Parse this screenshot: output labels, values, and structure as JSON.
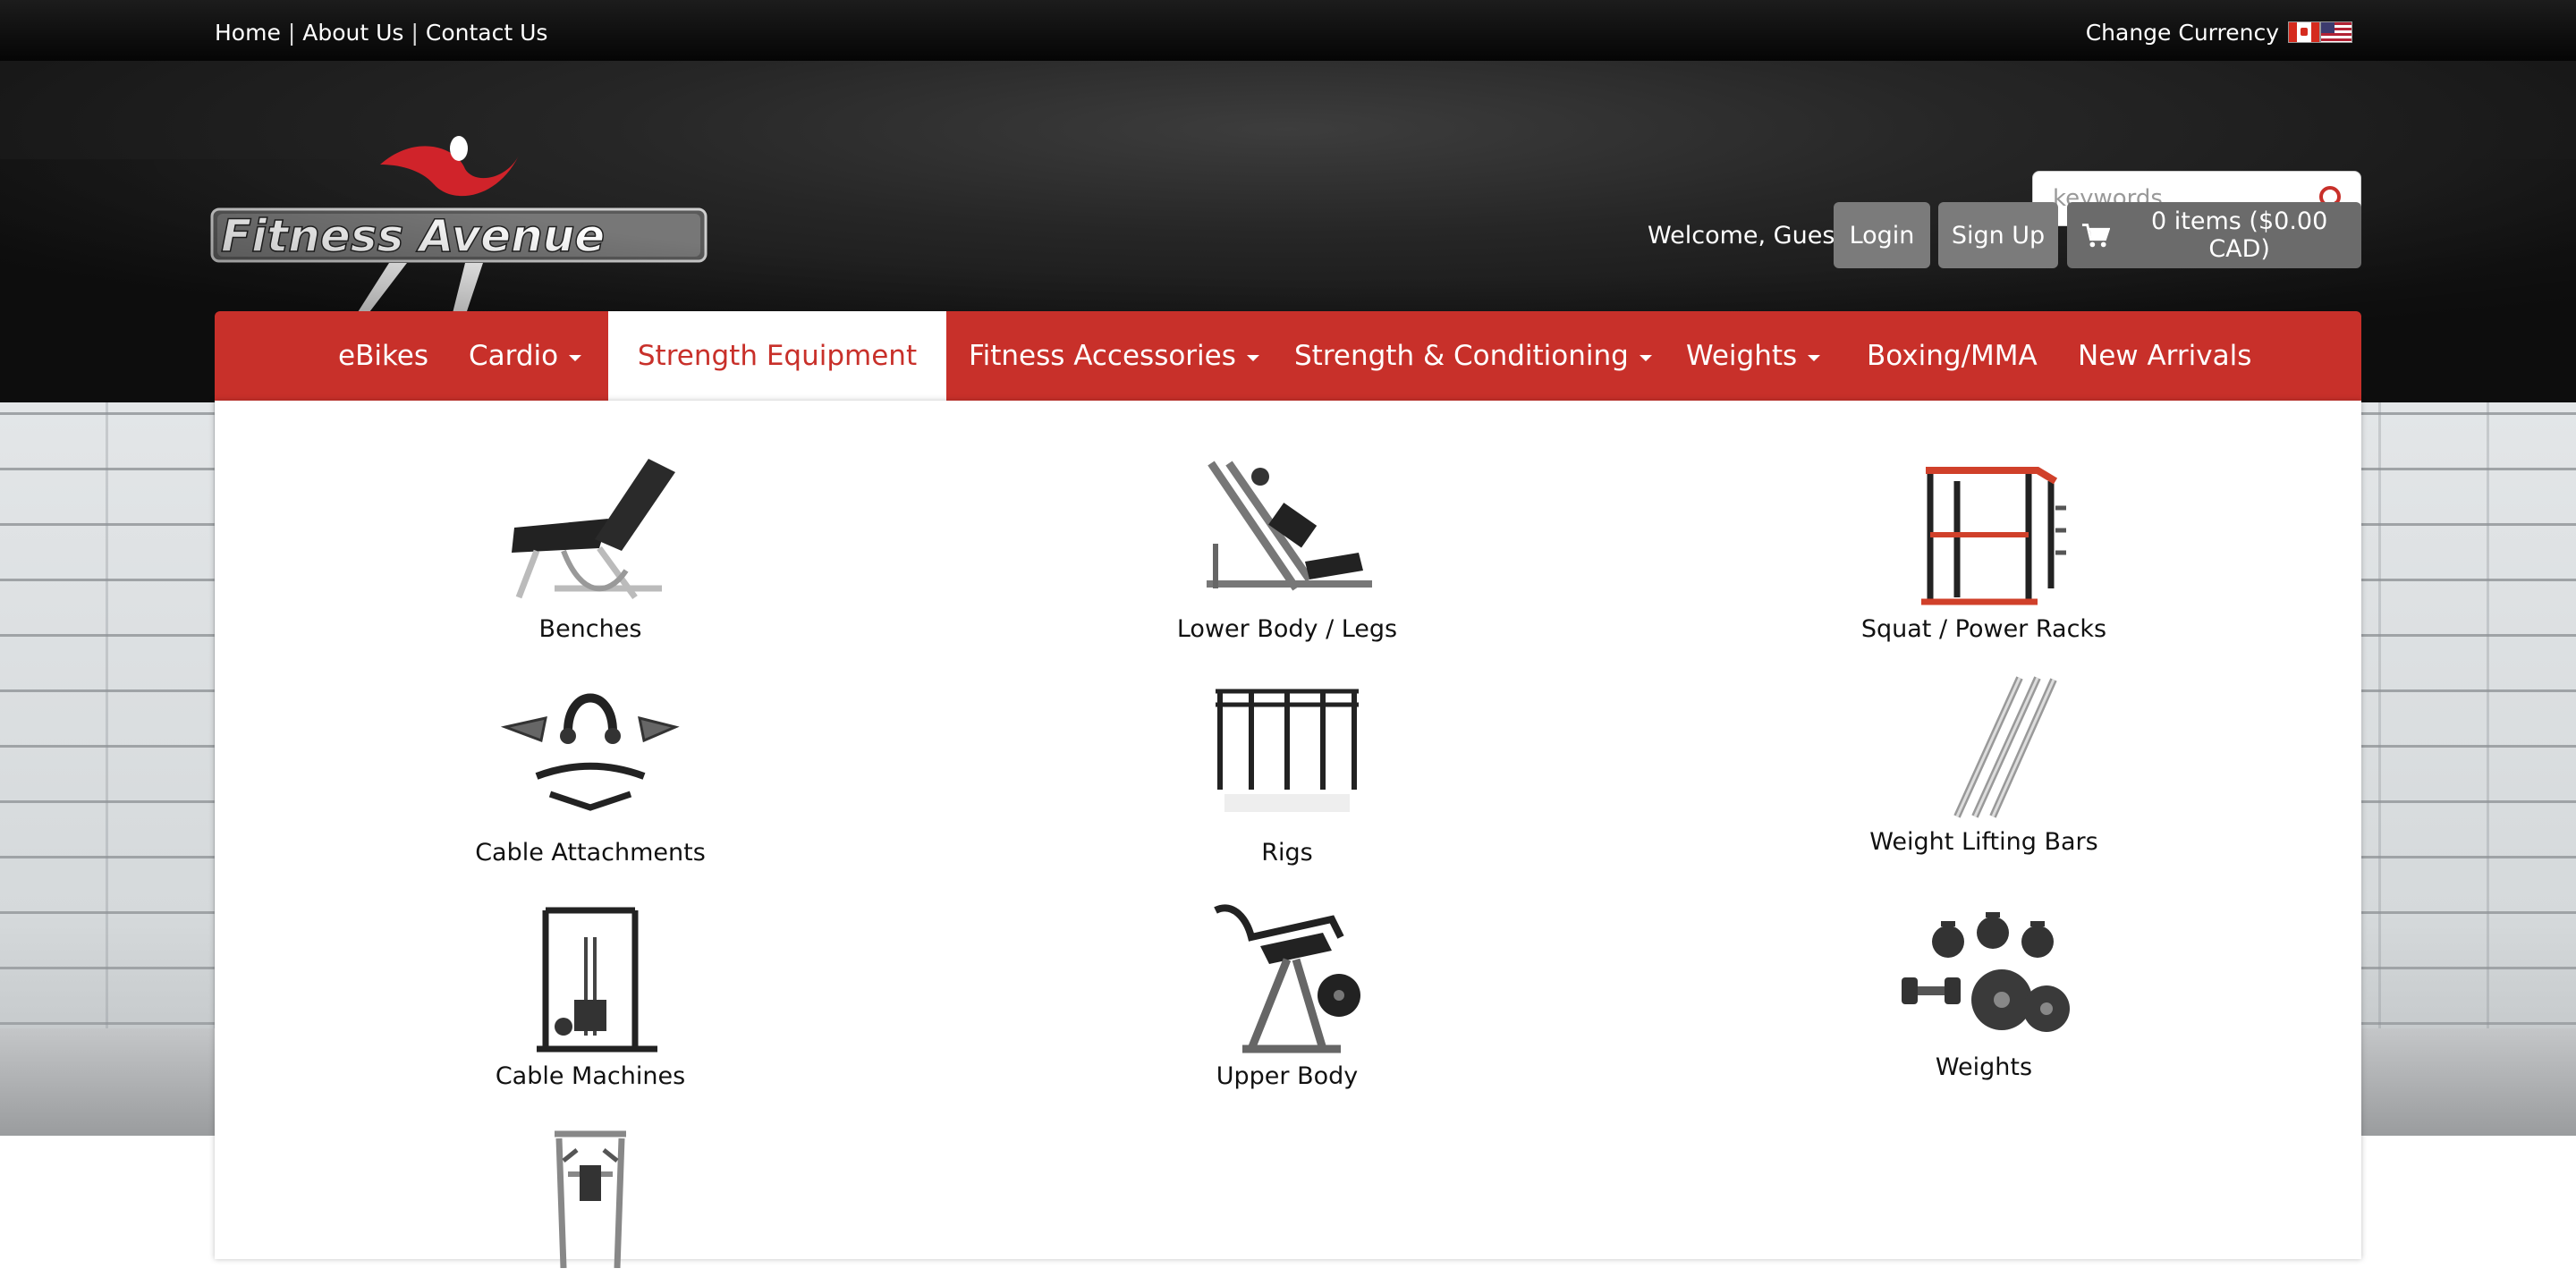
{
  "top_links": [
    "Home",
    "About Us",
    "Contact Us"
  ],
  "currency_label": "Change Currency",
  "currency_flags": [
    "canada-flag-icon",
    "us-flag-icon"
  ],
  "logo_text": "Fitness Avenue",
  "search": {
    "placeholder": "keywords"
  },
  "account": {
    "welcome": "Welcome, Guest",
    "login": "Login",
    "signup": "Sign Up",
    "cart": "0 items ($0.00 CAD)"
  },
  "nav": [
    {
      "label": "eBikes",
      "dropdown": false,
      "active": false
    },
    {
      "label": "Cardio",
      "dropdown": true,
      "active": false
    },
    {
      "label": "Strength Equipment",
      "dropdown": false,
      "active": true
    },
    {
      "label": "Fitness Accessories",
      "dropdown": true,
      "active": false
    },
    {
      "label": "Strength & Conditioning",
      "dropdown": true,
      "active": false
    },
    {
      "label": "Weights",
      "dropdown": true,
      "active": false
    },
    {
      "label": "Boxing/MMA",
      "dropdown": false,
      "active": false
    },
    {
      "label": "New Arrivals",
      "dropdown": false,
      "active": false
    }
  ],
  "categories": [
    {
      "label": "Benches",
      "icon": "bench-icon"
    },
    {
      "label": "Lower Body / Legs",
      "icon": "leg-press-icon"
    },
    {
      "label": "Squat / Power Racks",
      "icon": "power-rack-icon"
    },
    {
      "label": "Cable Attachments",
      "icon": "cable-attachments-icon"
    },
    {
      "label": "Rigs",
      "icon": "rig-icon"
    },
    {
      "label": "Weight Lifting Bars",
      "icon": "barbell-icon"
    },
    {
      "label": "Cable Machines",
      "icon": "cable-machine-icon"
    },
    {
      "label": "Upper Body",
      "icon": "upper-body-machine-icon"
    },
    {
      "label": "Weights",
      "icon": "weights-icon"
    },
    {
      "label": "",
      "icon": "power-tower-icon"
    }
  ],
  "colors": {
    "brand_red": "#c8302a",
    "button_gray": "#7b7b7b"
  }
}
